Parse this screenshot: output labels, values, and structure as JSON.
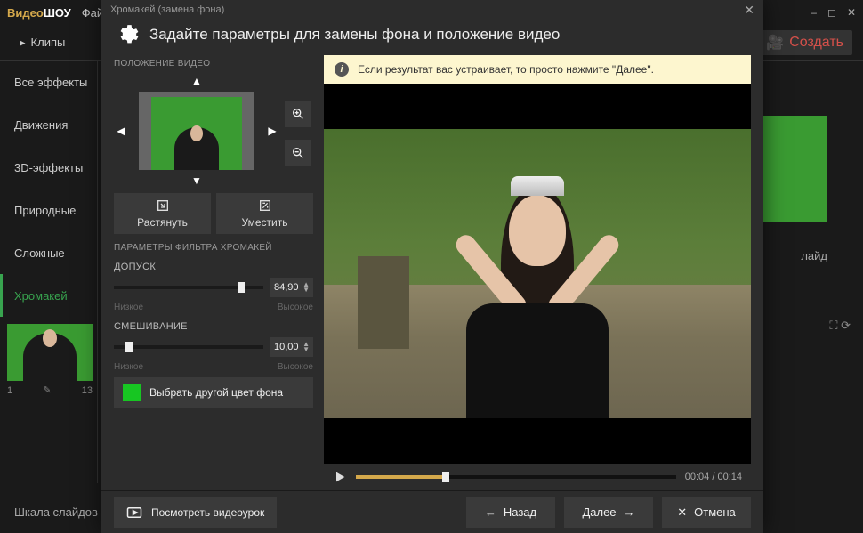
{
  "brand": {
    "a": "Видео",
    "b": "ШОУ"
  },
  "main_menu": {
    "file": "Фай"
  },
  "win_controls": [
    "–",
    "◻",
    "✕"
  ],
  "toolbar": {
    "clips": "Клипы",
    "create": "Создать"
  },
  "sidebar": {
    "items": [
      "Все эффекты",
      "Движения",
      "3D-эффекты",
      "Природные",
      "Сложные",
      "Хромакей"
    ],
    "active_index": 5
  },
  "clip": {
    "index": "1",
    "num": "13"
  },
  "right_panel": {
    "slide_label": "лайд"
  },
  "bottom": {
    "timeline_label": "Шкала слайдов"
  },
  "dialog": {
    "window_title": "Хромакей (замена фона)",
    "title": "Задайте параметры для замены фона и положение видео",
    "position_section": "ПОЛОЖЕНИЕ ВИДЕО",
    "arrows": {
      "up": "▲",
      "down": "▼",
      "left": "◀",
      "right": "▶"
    },
    "zoom_in": "⊕",
    "zoom_out": "⊖",
    "stretch_btn": "Растянуть",
    "fit_btn": "Уместить",
    "filter_section": "ПАРАМЕТРЫ ФИЛЬТРА ХРОМАКЕЙ",
    "tolerance": {
      "label": "ДОПУСК",
      "value": "84,90",
      "low": "Низкое",
      "high": "Высокое",
      "pos": 85
    },
    "blend": {
      "label": "СМЕШИВАНИЕ",
      "value": "10,00",
      "low": "Низкое",
      "high": "Высокое",
      "pos": 10
    },
    "color_btn": "Выбрать другой цвет фона",
    "bg_color": "#17c622",
    "info": "Если результат вас устраивает, то просто нажмите \"Далее\".",
    "time_current": "00:04",
    "time_total": "00:14",
    "footer": {
      "tutorial": "Посмотреть видеоурок",
      "back": "Назад",
      "next": "Далее",
      "cancel": "Отмена"
    }
  }
}
